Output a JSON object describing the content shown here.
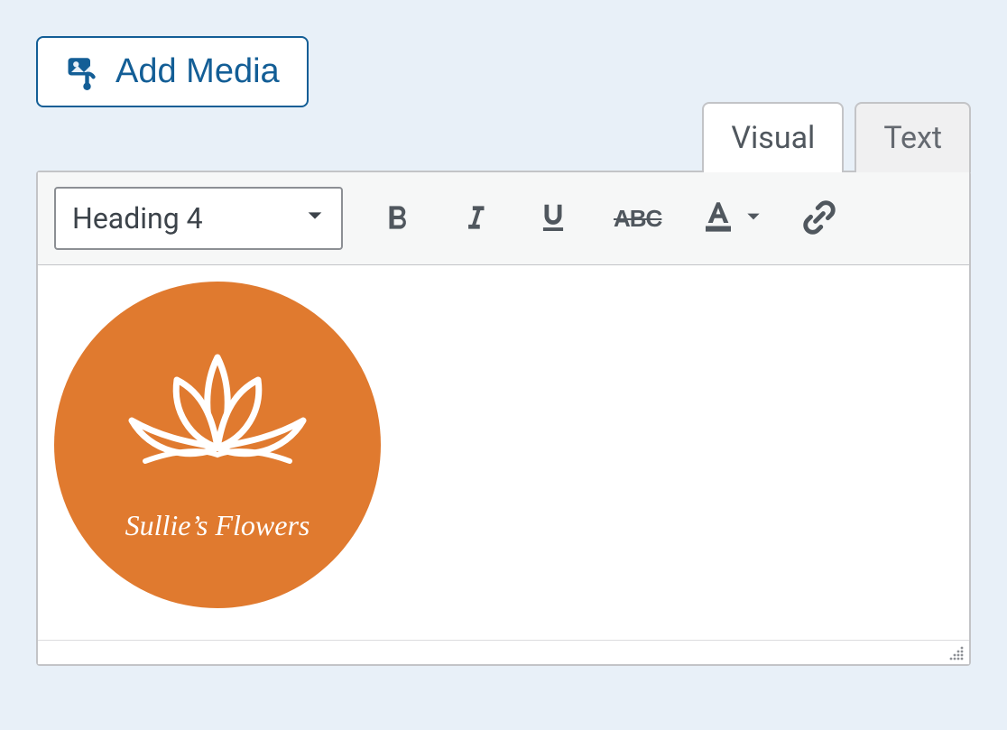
{
  "add_media_label": "Add Media",
  "tabs": {
    "visual": "Visual",
    "text": "Text"
  },
  "toolbar": {
    "format_selected": "Heading 4"
  },
  "content": {
    "logo_text": "Sullie’s Flowers",
    "logo_bg": "#e07a2f"
  }
}
